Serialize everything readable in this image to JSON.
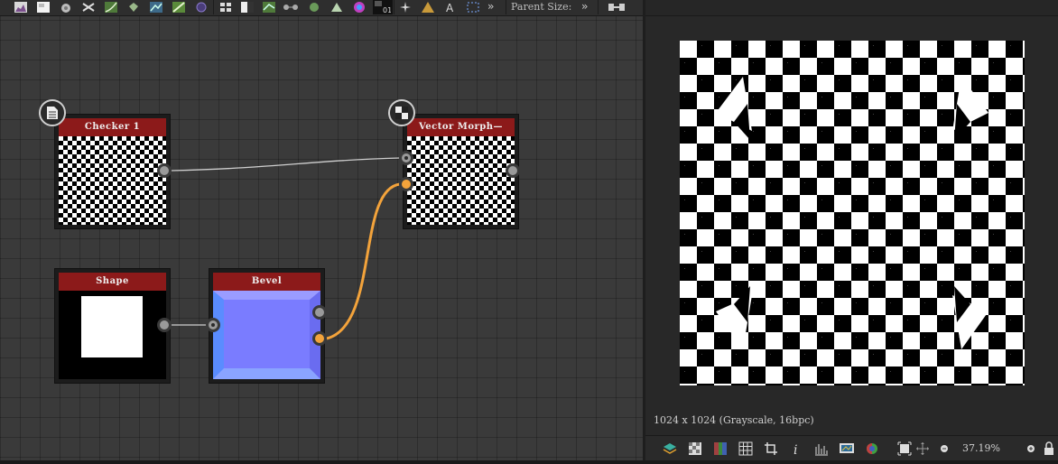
{
  "toolbar": {
    "parent_size_label": "Parent Size:",
    "overflow_glyph": "»",
    "icons": [
      "histogram-icon",
      "image-icon",
      "blur-icon",
      "shuffle-icon",
      "curve-icon",
      "bucket-icon",
      "levels-icon",
      "gradient-icon",
      "circle-icon",
      "grid-icon",
      "split-icon",
      "warp-icon",
      "nodes-icon",
      "sphere-icon",
      "triangle-icon",
      "color-wheel-icon",
      "bitmap-01-icon",
      "flare-icon",
      "warning-icon",
      "text-icon",
      "marquee-icon"
    ]
  },
  "graph": {
    "nodes": {
      "checker": {
        "title": "Checker 1"
      },
      "vector_morph": {
        "title": "Vector Morph—"
      },
      "shape": {
        "title": "Shape"
      },
      "bevel": {
        "title": "Bevel"
      }
    }
  },
  "preview": {
    "image_info": "1024 x 1024 (Grayscale, 16bpc)",
    "zoom": "37.19%",
    "statusbar_icons": [
      "layers-icon",
      "checker-icon",
      "color-channels-icon",
      "tile-grid-icon",
      "crop-icon",
      "info-icon",
      "histogram-icon",
      "display-icon",
      "color-sphere-icon",
      "fit-icon",
      "move-icon",
      "zoom-out-icon",
      "zoom-in-icon",
      "lock-icon"
    ]
  },
  "colors": {
    "node_header": "#8c1a1a",
    "orange_wire": "#f3a33b",
    "bevel_blue": "#7a7cff"
  }
}
